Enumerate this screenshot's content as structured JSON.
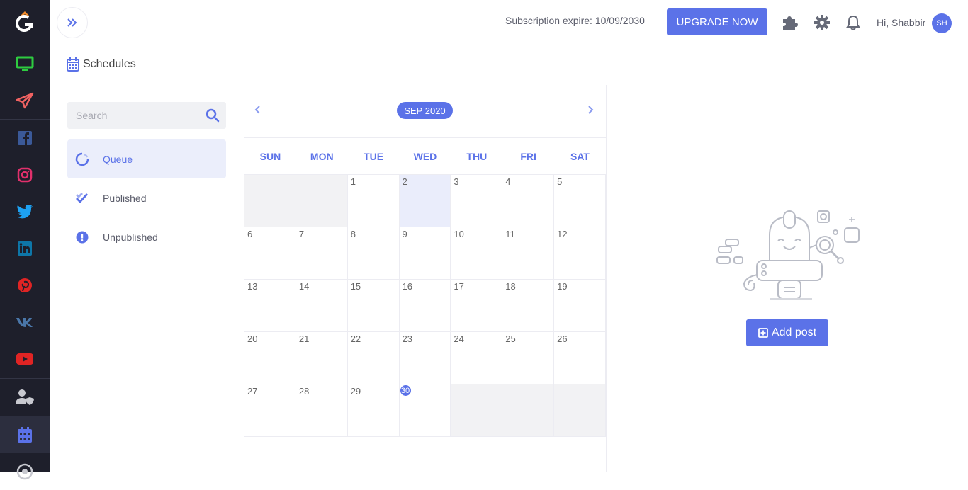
{
  "header": {
    "subscription_text": "Subscription expire: 10/09/2030",
    "upgrade_label": "UPGRADE NOW",
    "greeting": "Hi, Shabbir",
    "avatar_initials": "SH"
  },
  "page": {
    "title": "Schedules"
  },
  "search": {
    "placeholder": "Search"
  },
  "filters": [
    {
      "label": "Queue",
      "icon": "circle-notch-icon",
      "active": true
    },
    {
      "label": "Published",
      "icon": "double-check-icon",
      "active": false
    },
    {
      "label": "Unpublished",
      "icon": "exclamation-circle-icon",
      "active": false
    }
  ],
  "calendar": {
    "month_label": "SEP 2020",
    "weekdays": [
      "SUN",
      "MON",
      "TUE",
      "WED",
      "THU",
      "FRI",
      "SAT"
    ],
    "weeks": [
      [
        "",
        "",
        "1",
        "2",
        "3",
        "4",
        "5"
      ],
      [
        "6",
        "7",
        "8",
        "9",
        "10",
        "11",
        "12"
      ],
      [
        "13",
        "14",
        "15",
        "16",
        "17",
        "18",
        "19"
      ],
      [
        "20",
        "21",
        "22",
        "23",
        "24",
        "25",
        "26"
      ],
      [
        "27",
        "28",
        "29",
        "30",
        "",
        "",
        ""
      ]
    ],
    "selected_day": "2",
    "today": "30"
  },
  "empty_state": {
    "add_post_label": "Add post"
  },
  "colors": {
    "accent": "#5b72e8",
    "sidebar_bg": "#1e1f2b"
  }
}
